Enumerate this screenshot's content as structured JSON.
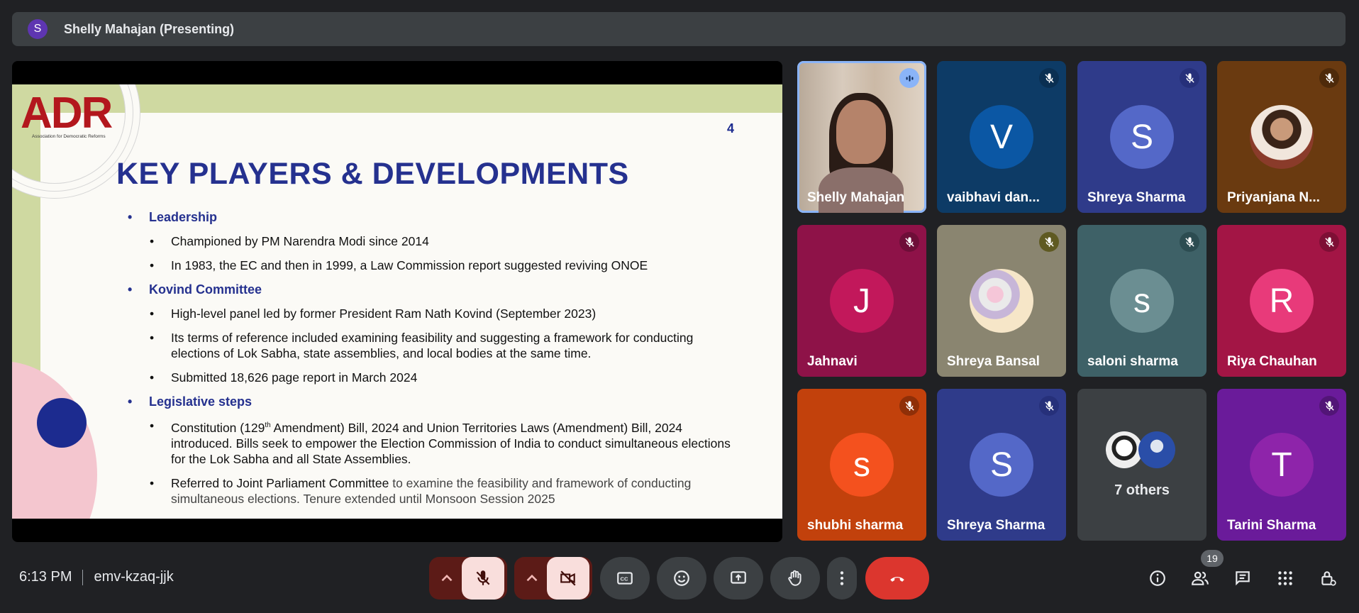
{
  "presenter_bar": {
    "avatar_initial": "S",
    "label": "Shelly Mahajan (Presenting)"
  },
  "slide": {
    "logo_text": "ADR",
    "logo_subtitle": "Association for Democratic Reforms",
    "page_number": "4",
    "title": "KEY PLAYERS & DEVELOPMENTS",
    "sections": [
      {
        "heading": "Leadership",
        "points": [
          "Championed by PM Narendra Modi since 2014",
          "In 1983, the EC and then in 1999, a Law Commission report suggested reviving ONOE"
        ]
      },
      {
        "heading": "Kovind Committee",
        "points": [
          "High-level panel led by former President Ram Nath Kovind (September 2023)",
          "Its terms of reference included examining feasibility and suggesting a framework for conducting elections of Lok Sabha, state assemblies, and local bodies at the same time.",
          "Submitted 18,626 page report in March 2024"
        ]
      },
      {
        "heading": "Legislative steps",
        "points": [
          "Constitution (129th Amendment) Bill, 2024 and Union Territories Laws (Amendment) Bill, 2024 introduced. Bills seek to empower the Election Commission of India to conduct simultaneous elections for the Lok Sabha and all State Assemblies."
        ],
        "last_point_lead": "Referred to Joint Parliament Committee",
        "last_point_rest": " to examine the feasibility and framework of conducting simultaneous elections. Tenure extended until Monsoon Session 2025"
      }
    ],
    "constitution_parts": {
      "a": "Constitution (129",
      "sup": "th",
      "b": " Amendment) Bill, 2024 and Union Territories Laws (Amendment) Bill, 2024 introduced. Bills seek to empower the Election Commission of India to conduct simultaneous elections for the Lok Sabha and all State Assemblies."
    }
  },
  "participants": [
    {
      "name": "Shelly Mahajan",
      "type": "video",
      "speaking": true
    },
    {
      "name": "vaibhavi dan...",
      "initial": "V",
      "color": "#0b57a4",
      "bg": "#0d3b66",
      "mic_bg": "#0a2f52"
    },
    {
      "name": "Shreya Sharma",
      "initial": "S",
      "color": "#5468c8",
      "bg": "#2f3b8a",
      "mic_bg": "#26307a"
    },
    {
      "name": "Priyanjana N...",
      "type": "photo",
      "bg": "#6a3a10",
      "mic_bg": "#4e2a0a"
    },
    {
      "name": "Jahnavi",
      "initial": "J",
      "color": "#c2185b",
      "bg": "#8e1248",
      "mic_bg": "#6e0e38"
    },
    {
      "name": "Shreya Bansal",
      "type": "photo",
      "bg": "#8a8570",
      "mic_bg": "#5f5a22"
    },
    {
      "name": "saloni sharma",
      "initial": "s",
      "color": "#6b8e92",
      "bg": "#3e6167",
      "mic_bg": "#2c4c51"
    },
    {
      "name": "Riya Chauhan",
      "initial": "R",
      "color": "#e83a7a",
      "bg": "#a31545",
      "mic_bg": "#7e0f35"
    },
    {
      "name": "shubhi sharma",
      "initial": "s",
      "color": "#f4511e",
      "bg": "#c2410c",
      "mic_bg": "#8f2f08"
    },
    {
      "name": "Shreya Sharma",
      "initial": "S",
      "color": "#5468c8",
      "bg": "#2f3b8a",
      "mic_bg": "#26307a"
    },
    {
      "name": "7 others",
      "type": "others",
      "bg": "#3c4043"
    },
    {
      "name": "Tarini Sharma",
      "initial": "T",
      "color": "#8e24aa",
      "bg": "#6a1b9a",
      "mic_bg": "#521577"
    }
  ],
  "footer": {
    "time": "6:13 PM",
    "meeting_code": "emv-kzaq-jjk",
    "participant_count": "19"
  }
}
